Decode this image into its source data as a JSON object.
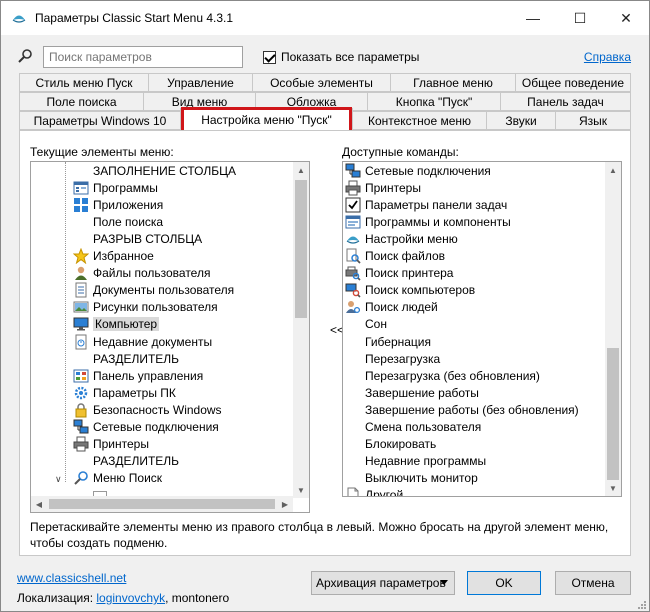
{
  "window": {
    "title": "Параметры Classic Start Menu 4.3.1",
    "minimize": "—",
    "maximize": "☐",
    "close": "✕"
  },
  "search": {
    "placeholder": "Поиск параметров",
    "show_all_label": "Показать все параметры",
    "help_label": "Справка"
  },
  "tabs": {
    "row1": [
      "Стиль меню Пуск",
      "Управление",
      "Особые элементы",
      "Главное меню",
      "Общее поведение"
    ],
    "row2": [
      "Поле поиска",
      "Вид меню",
      "Обложка",
      "Кнопка \"Пуск\"",
      "Панель задач"
    ],
    "row3": [
      "Параметры Windows 10",
      "Настройка меню \"Пуск\"",
      "Контекстное меню",
      "Звуки",
      "Язык"
    ],
    "active": "Настройка меню \"Пуск\""
  },
  "left_list": {
    "label": "Текущие элементы меню:",
    "items": [
      {
        "text": "ЗАПОЛНЕНИЕ СТОЛБЦА",
        "icon": "none"
      },
      {
        "text": "Программы",
        "icon": "programs-icon"
      },
      {
        "text": "Приложения",
        "icon": "apps-icon"
      },
      {
        "text": "Поле поиска",
        "icon": "none"
      },
      {
        "text": "РАЗРЫВ СТОЛБЦА",
        "icon": "none"
      },
      {
        "text": "Избранное",
        "icon": "star-icon"
      },
      {
        "text": "Файлы пользователя",
        "icon": "user-icon"
      },
      {
        "text": "Документы пользователя",
        "icon": "documents-icon"
      },
      {
        "text": "Рисунки пользователя",
        "icon": "pictures-icon"
      },
      {
        "text": "Компьютер",
        "icon": "computer-icon",
        "selected": true
      },
      {
        "text": "Недавние документы",
        "icon": "recent-icon"
      },
      {
        "text": "РАЗДЕЛИТЕЛЬ",
        "icon": "none"
      },
      {
        "text": "Панель управления",
        "icon": "control-panel-icon"
      },
      {
        "text": "Параметры ПК",
        "icon": "pc-settings-icon"
      },
      {
        "text": "Безопасность Windows",
        "icon": "lock-icon"
      },
      {
        "text": "Сетевые подключения",
        "icon": "network-icon"
      },
      {
        "text": "Принтеры",
        "icon": "printer-icon"
      },
      {
        "text": "РАЗДЕЛИТЕЛЬ",
        "icon": "none"
      },
      {
        "text": "Меню Поиск",
        "icon": "search-icon"
      }
    ]
  },
  "right_list": {
    "label": "Доступные команды:",
    "items": [
      {
        "text": "Сетевые подключения",
        "icon": "network-icon"
      },
      {
        "text": "Принтеры",
        "icon": "printer-icon"
      },
      {
        "text": "Параметры панели задач",
        "icon": "taskbar-icon"
      },
      {
        "text": "Программы и компоненты",
        "icon": "programs-features-icon"
      },
      {
        "text": "Настройки меню",
        "icon": "menu-settings-icon"
      },
      {
        "text": "Поиск файлов",
        "icon": "search-files-icon"
      },
      {
        "text": "Поиск принтера",
        "icon": "search-printer-icon"
      },
      {
        "text": "Поиск компьютеров",
        "icon": "search-computers-icon"
      },
      {
        "text": "Поиск людей",
        "icon": "search-people-icon"
      },
      {
        "text": "Сон",
        "icon": "none"
      },
      {
        "text": "Гибернация",
        "icon": "none"
      },
      {
        "text": "Перезагрузка",
        "icon": "none"
      },
      {
        "text": "Перезагрузка (без обновления)",
        "icon": "none"
      },
      {
        "text": "Завершение работы",
        "icon": "none"
      },
      {
        "text": "Завершение работы (без обновления)",
        "icon": "none"
      },
      {
        "text": "Смена пользователя",
        "icon": "none"
      },
      {
        "text": "Блокировать",
        "icon": "none"
      },
      {
        "text": "Недавние программы",
        "icon": "none"
      },
      {
        "text": "Выключить монитор",
        "icon": "none"
      },
      {
        "text": "Другой",
        "icon": "blank-page-icon"
      }
    ]
  },
  "move_button": "<<",
  "hint": "Перетаскивайте элементы меню из правого столбца в левый. Можно бросать на другой элемент меню, чтобы создать подменю.",
  "footer": {
    "site_link": "www.classicshell.net",
    "localization_label": "Локализация:",
    "localizer_link": "loginvovchyk",
    "localizer_rest": ", montonero",
    "backup_button": "Архивация параметров",
    "ok_button": "OK",
    "cancel_button": "Отмена"
  },
  "colors": {
    "highlight": "#d0161a",
    "link": "#0066cc"
  }
}
